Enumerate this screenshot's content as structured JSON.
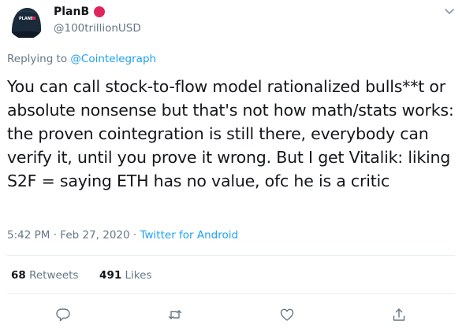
{
  "author": {
    "display_name": "PlanB",
    "handle": "@100trillionUSD",
    "avatar_text": "PLANB",
    "badge_color": "#e0245e"
  },
  "reply": {
    "prefix": "Replying to",
    "target": "@Cointelegraph"
  },
  "tweet": {
    "text": "You can call stock-to-flow model rationalized bulls**t or absolute nonsense but that's not how math/stats works: the proven cointegration is still there, everybody can verify it, until you prove it wrong. But I get Vitalik: liking S2F = saying ETH has no value, ofc he is a critic"
  },
  "meta": {
    "time": "5:42 PM",
    "separator_1": "·",
    "date": "Feb 27, 2020",
    "separator_2": "·",
    "source": "Twitter for Android"
  },
  "stats": {
    "retweets_count": "68",
    "retweets_label": "Retweets",
    "likes_count": "491",
    "likes_label": "Likes"
  },
  "colors": {
    "accent": "#1da1f2",
    "muted": "#657786",
    "text": "#14171a",
    "divider": "#e6ecf0"
  },
  "icons": {
    "menu": "chevron-down-icon",
    "reply": "reply-icon",
    "retweet": "retweet-icon",
    "like": "heart-icon",
    "share": "share-icon"
  }
}
